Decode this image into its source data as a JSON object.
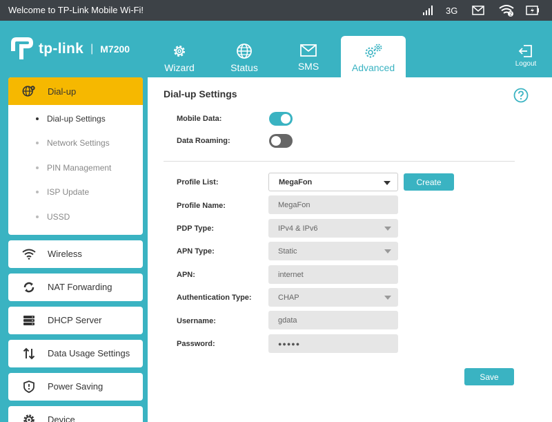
{
  "statusbar": {
    "welcome": "Welcome to TP-Link Mobile Wi-Fi!",
    "network": "3G",
    "icons": [
      "signal-icon",
      "mail-icon",
      "wifi-icon",
      "battery-icon"
    ]
  },
  "header": {
    "brand": "tp-link",
    "model": "M7200",
    "separator": "|",
    "tabs": [
      {
        "label": "Wizard",
        "icon": "gear-icon"
      },
      {
        "label": "Status",
        "icon": "globe-icon"
      },
      {
        "label": "SMS",
        "icon": "mail-icon"
      },
      {
        "label": "Advanced",
        "icon": "gears-icon",
        "active": true
      }
    ],
    "logout": "Logout"
  },
  "sidebar": {
    "dialup": {
      "label": "Dial-up",
      "items": [
        "Dial-up Settings",
        "Network Settings",
        "PIN Management",
        "ISP Update",
        "USSD"
      ]
    },
    "sections": [
      {
        "label": "Wireless",
        "icon": "wifi-icon"
      },
      {
        "label": "NAT Forwarding",
        "icon": "nat-icon"
      },
      {
        "label": "DHCP Server",
        "icon": "server-icon"
      },
      {
        "label": "Data Usage Settings",
        "icon": "data-usage-icon"
      },
      {
        "label": "Power Saving",
        "icon": "shield-icon"
      },
      {
        "label": "Device",
        "icon": "gear-icon"
      }
    ]
  },
  "main": {
    "title": "Dial-up Settings",
    "mobile_data": {
      "label": "Mobile Data:",
      "on": true
    },
    "data_roaming": {
      "label": "Data Roaming:",
      "on": false
    },
    "profile_list": {
      "label": "Profile List:",
      "value": "MegaFon"
    },
    "create_label": "Create",
    "profile_name": {
      "label": "Profile Name:",
      "value": "MegaFon"
    },
    "pdp_type": {
      "label": "PDP Type:",
      "value": "IPv4 & IPv6"
    },
    "apn_type": {
      "label": "APN Type:",
      "value": "Static"
    },
    "apn": {
      "label": "APN:",
      "value": "internet"
    },
    "auth_type": {
      "label": "Authentication Type:",
      "value": "CHAP"
    },
    "username": {
      "label": "Username:",
      "value": "gdata"
    },
    "password": {
      "label": "Password:",
      "value": "●●●●●"
    },
    "save_label": "Save"
  },
  "colors": {
    "accent": "#3ab3c2",
    "active_menu": "#f6b800",
    "statusbar": "#3d4247"
  }
}
